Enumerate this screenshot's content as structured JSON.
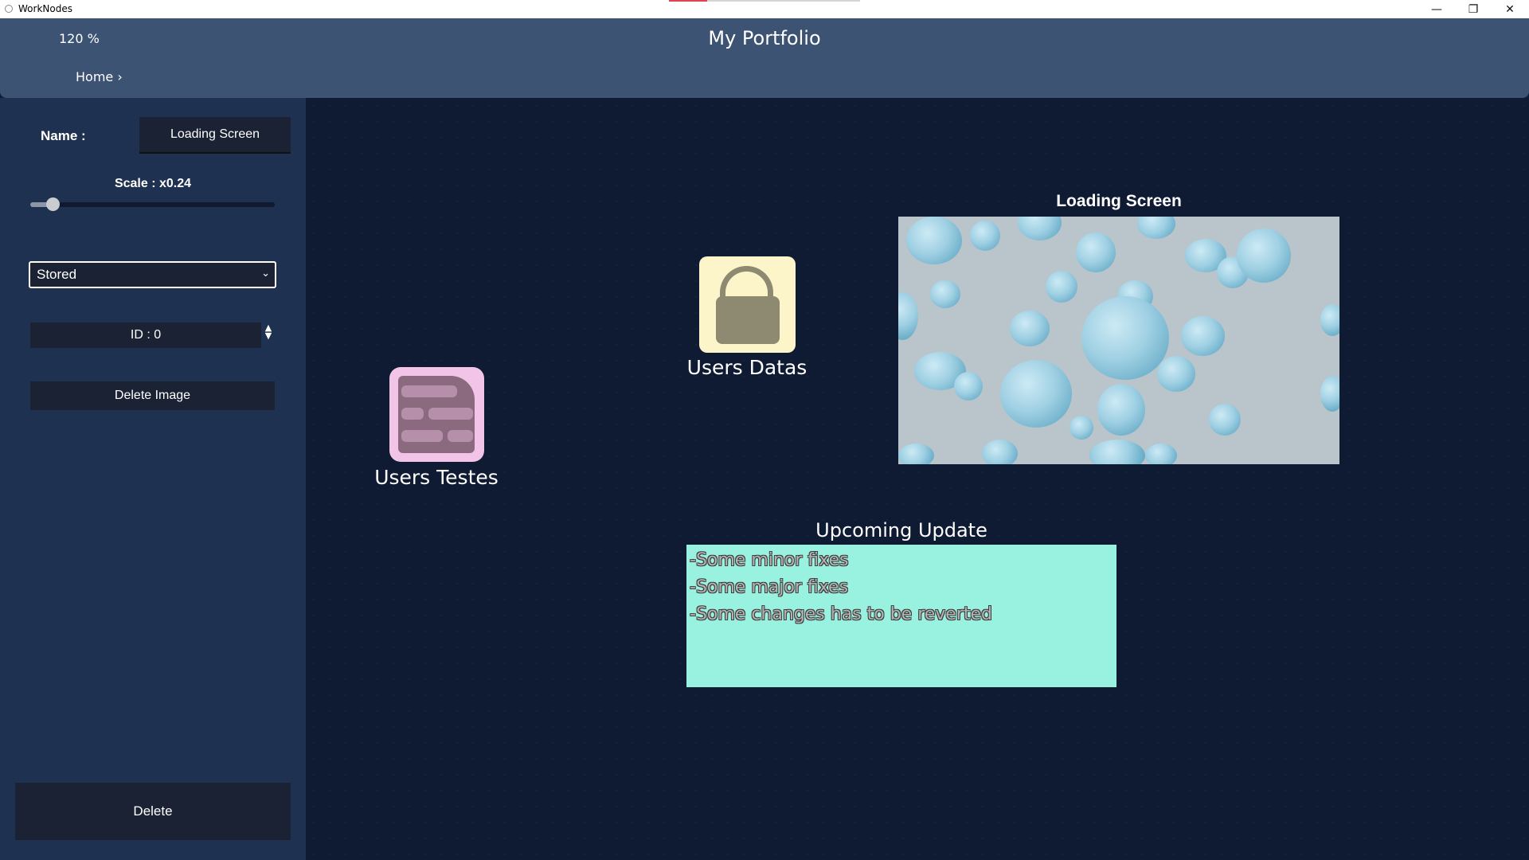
{
  "window": {
    "app_title": "WorkNodes",
    "minimize_glyph": "—",
    "maximize_glyph": "❐",
    "close_glyph": "✕"
  },
  "header": {
    "zoom": "120 %",
    "title": "My Portfolio",
    "breadcrumb": "Home ›"
  },
  "sidebar": {
    "name_label": "Name :",
    "name_value": "Loading Screen",
    "scale_label": "Scale : x0.24",
    "scale_value": 0.24,
    "slider_fraction": 0.09,
    "storage_select": "Stored",
    "id_label": "ID :  0",
    "delete_image_label": "Delete Image",
    "delete_label": "Delete"
  },
  "canvas": {
    "nodes": {
      "users_testes": "Users Testes",
      "users_datas": "Users Datas"
    },
    "image_node": {
      "title": "Loading Screen"
    },
    "note": {
      "title": "Upcoming Update",
      "lines": [
        "-Some minor fixes",
        "-Some major fixes",
        "-Some changes has to be reverted"
      ]
    }
  },
  "colors": {
    "header_bg": "#3d5373",
    "sidebar_bg": "#1f3150",
    "canvas_bg": "#0f1a33",
    "testes_icon_bg": "#f2c4e8",
    "datas_icon_bg": "#fbf5c9",
    "note_bg": "#99f2e0",
    "titlebar_accent": "#e0454f"
  },
  "icons": {
    "app": "app-icon",
    "testes": "document-table-icon",
    "datas": "lock-icon",
    "id_spinner": "spinner-arrows-icon",
    "select": "chevron-down-icon"
  }
}
